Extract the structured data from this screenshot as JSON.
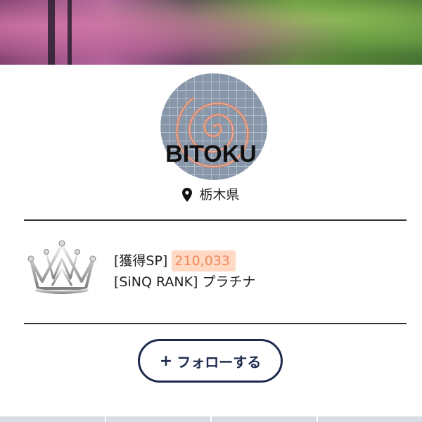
{
  "profile": {
    "name": "BITOKU",
    "location": "栃木県"
  },
  "stats": {
    "sp_label": "[獲得SP]",
    "sp_value": "210,033",
    "rank_label": "[SiNQ RANK]",
    "rank_value": "プラチナ"
  },
  "actions": {
    "follow_label": "フォローする",
    "follow_icon": "+"
  },
  "icons": {
    "location": "map-pin-icon",
    "rank": "crown-icon"
  },
  "colors": {
    "button_border": "#1d2b4d",
    "sp_highlight_bg": "#ffd9c4",
    "sp_highlight_text": "#f08a5d"
  }
}
